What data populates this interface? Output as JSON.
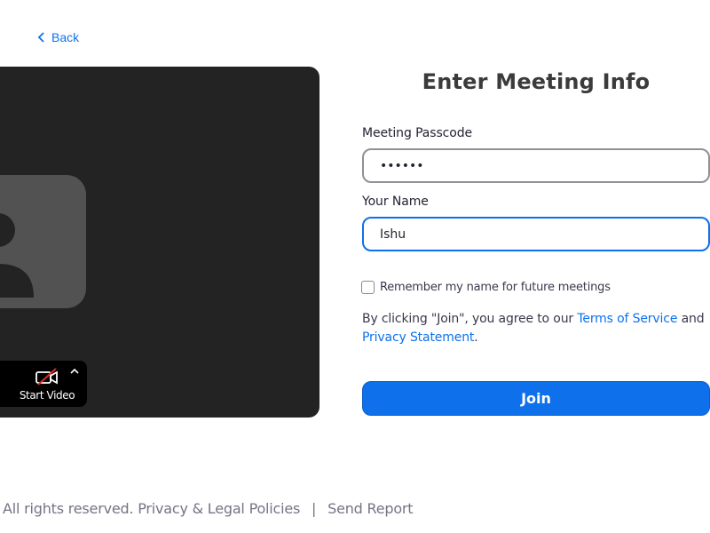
{
  "navigation": {
    "back_label": "Back",
    "back_icon": "chevron-left-icon"
  },
  "preview": {
    "start_video_label": "Start Video",
    "video_icon": "video-off-icon",
    "caret_icon": "chevron-up-icon",
    "avatar_icon": "user-silhouette-icon"
  },
  "form": {
    "title": "Enter Meeting Info",
    "passcode_label": "Meeting Passcode",
    "passcode_value": "••••••",
    "name_label": "Your Name",
    "name_value": "Ishu",
    "remember_label": "Remember my name for future meetings",
    "remember_checked": false,
    "agree_prefix": "By clicking \"Join\", you agree to our ",
    "terms_link": "Terms of Service",
    "agree_middle": " and",
    "privacy_link": "Privacy Statement",
    "agree_suffix": ".",
    "join_label": "Join"
  },
  "footer": {
    "rights_text": "All rights reserved.",
    "privacy_legal_link": "Privacy & Legal Policies",
    "separator": "|",
    "send_report_link": "Send Report"
  },
  "colors": {
    "accent": "#0e71eb",
    "preview_bg": "#232323",
    "avatar_bg": "#525252",
    "muted_text": "#747487"
  }
}
